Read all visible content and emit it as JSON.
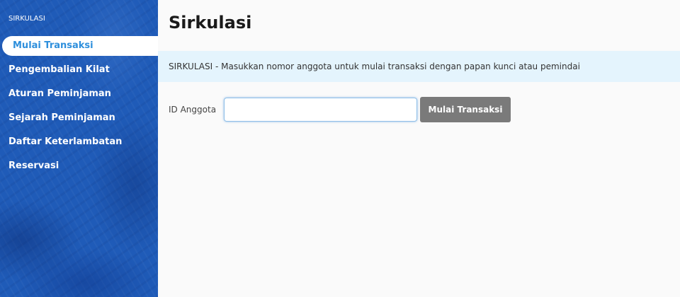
{
  "sidebar": {
    "heading": "SIRKULASI",
    "items": [
      {
        "label": "Mulai Transaksi",
        "active": true
      },
      {
        "label": "Pengembalian Kilat",
        "active": false
      },
      {
        "label": "Aturan Peminjaman",
        "active": false
      },
      {
        "label": "Sejarah Peminjaman",
        "active": false
      },
      {
        "label": "Daftar Keterlambatan",
        "active": false
      },
      {
        "label": "Reservasi",
        "active": false
      }
    ]
  },
  "main": {
    "title": "Sirkulasi",
    "info": "SIRKULASI - Masukkan nomor anggota untuk mulai transaksi dengan papan kunci atau pemindai",
    "form": {
      "label": "ID Anggota",
      "input_value": "",
      "button_label": "Mulai Transaksi"
    }
  },
  "colors": {
    "sidebar_bg": "#1f5bb8",
    "active_text": "#2e8fdc",
    "info_bg": "#e4f4fd",
    "button_bg": "#7a7a7a"
  }
}
